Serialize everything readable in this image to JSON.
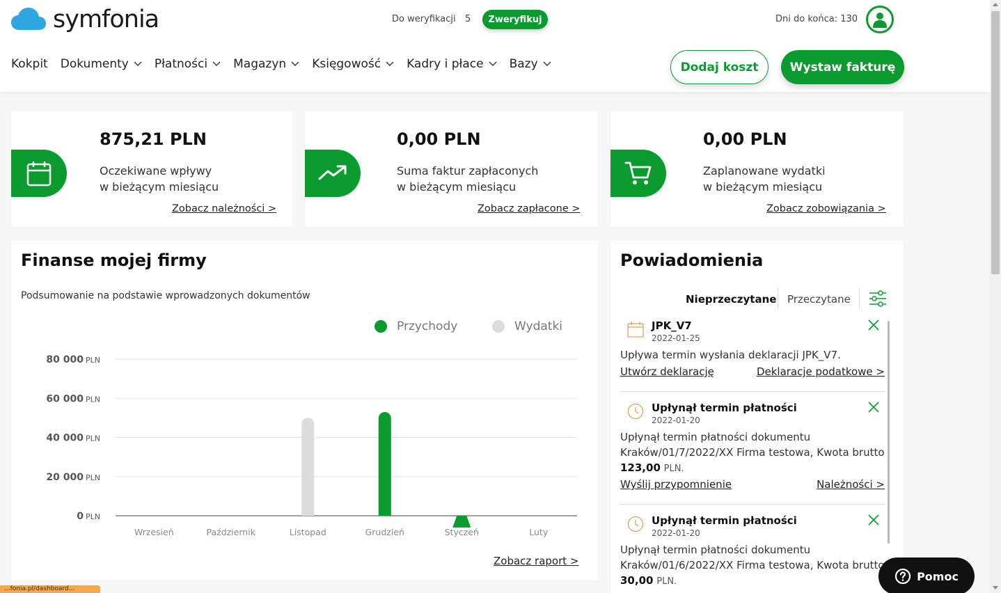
{
  "brand": {
    "name": "symfonia",
    "color": "#0a9b2e",
    "cloud_color": "#2ea7e0"
  },
  "topbar": {
    "verify_label": "Do weryfikacji",
    "verify_count": "5",
    "verify_button": "Zweryfikuj",
    "days_left": "Dni do końca: 130",
    "user_icon": "user-icon"
  },
  "nav": {
    "items": [
      {
        "label": "Kokpit",
        "dropdown": false
      },
      {
        "label": "Dokumenty",
        "dropdown": true
      },
      {
        "label": "Płatności",
        "dropdown": true
      },
      {
        "label": "Magazyn",
        "dropdown": true
      },
      {
        "label": "Księgowość",
        "dropdown": true
      },
      {
        "label": "Kadry i płace",
        "dropdown": true
      },
      {
        "label": "Bazy",
        "dropdown": true
      }
    ],
    "add_cost": "Dodaj koszt",
    "issue_invoice": "Wystaw fakturę"
  },
  "summary": [
    {
      "icon": "calendar-icon",
      "amount": "875,21 PLN",
      "line1": "Oczekiwane wpływy",
      "line2": "w bieżącym miesiącu",
      "link": "Zobacz należności >"
    },
    {
      "icon": "trend-up-icon",
      "amount": "0,00 PLN",
      "line1": "Suma faktur zapłaconych",
      "line2": "w bieżącym miesiącu",
      "link": "Zobacz zapłacone >"
    },
    {
      "icon": "cart-icon",
      "amount": "0,00 PLN",
      "line1": "Zaplanowane wydatki",
      "line2": "w bieżącym miesiącu",
      "link": "Zobacz zobowiązania >"
    }
  ],
  "finance": {
    "title": "Finanse mojej firmy",
    "subtitle": "Podsumowanie na podstawie wprowadzonych dokumentów",
    "report_link": "Zobacz raport >"
  },
  "chart_data": {
    "type": "bar",
    "categories": [
      "Wrzesień",
      "Październik",
      "Listopad",
      "Grudzień",
      "Styczeń",
      "Luty"
    ],
    "series": [
      {
        "name": "Przychody",
        "color": "#0a9b2e",
        "values": [
          0,
          0,
          0,
          53000,
          -6000,
          0
        ]
      },
      {
        "name": "Wydatki",
        "color": "#dcdcdc",
        "values": [
          0,
          0,
          50000,
          0,
          0,
          0
        ]
      }
    ],
    "y_ticks": [
      {
        "value": 80000,
        "num": "80 000",
        "unit": "PLN"
      },
      {
        "value": 60000,
        "num": "60 000",
        "unit": "PLN"
      },
      {
        "value": 40000,
        "num": "40 000",
        "unit": "PLN"
      },
      {
        "value": 20000,
        "num": "20 000",
        "unit": "PLN"
      },
      {
        "value": 0,
        "num": "0",
        "unit": "PLN"
      }
    ],
    "ylim": [
      0,
      80000
    ],
    "legend_position": "top-right",
    "grid": true
  },
  "notifications": {
    "title": "Powiadomienia",
    "tab_unread": "Nieprzeczytane",
    "tab_read": "Przeczytane",
    "items": [
      {
        "icon": "calendar-icon",
        "title": "JPK_V7",
        "date": "2022-01-25",
        "body": "Upływa termin wysłania deklaracji JPK_V7.",
        "link_left": "Utwórz deklarację",
        "link_right": "Deklaracje podatkowe >"
      },
      {
        "icon": "clock-icon",
        "title": "Upłynął termin płatności",
        "date": "2022-01-20",
        "body1": "Upłynął termin płatności dokumentu",
        "body2": "Kraków/01/7/2022/XX Firma testowa, Kwota brutto",
        "amount": "123,00",
        "currency": "PLN.",
        "link_left": "Wyślij przypomnienie",
        "link_right": "Należności >"
      },
      {
        "icon": "clock-icon",
        "title": "Upłynął termin płatności",
        "date": "2022-01-20",
        "body1": "Upłynął termin płatności dokumentu",
        "body2": "Kraków/01/6/2022/XX Firma testowa, Kwota brutto",
        "amount": "30,00",
        "currency": "PLN."
      }
    ]
  },
  "help": {
    "label": "Pomoc"
  },
  "status": {
    "url": "...fonia.pl/dashboard..."
  }
}
